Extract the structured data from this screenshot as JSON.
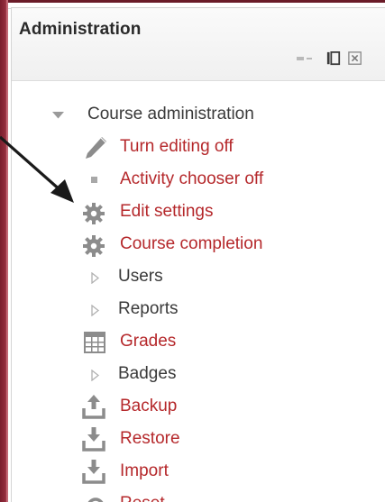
{
  "block": {
    "title": "Administration"
  },
  "admin_tree": {
    "root": {
      "label": "Course administration",
      "icon": "triangle-down-icon",
      "expanded": true
    },
    "items": [
      {
        "label": "Turn editing off",
        "icon": "pencil-icon",
        "kind": "link"
      },
      {
        "label": "Activity chooser off",
        "icon": "bullet-icon",
        "kind": "link"
      },
      {
        "label": "Edit settings",
        "icon": "gear-icon",
        "kind": "link"
      },
      {
        "label": "Course completion",
        "icon": "gear-icon",
        "kind": "link"
      },
      {
        "label": "Users",
        "icon": "triangle-right-icon",
        "kind": "branch"
      },
      {
        "label": "Reports",
        "icon": "triangle-right-icon",
        "kind": "branch"
      },
      {
        "label": "Grades",
        "icon": "table-icon",
        "kind": "link"
      },
      {
        "label": "Badges",
        "icon": "triangle-right-icon",
        "kind": "branch"
      },
      {
        "label": "Backup",
        "icon": "upload-icon",
        "kind": "link"
      },
      {
        "label": "Restore",
        "icon": "download-icon",
        "kind": "link"
      },
      {
        "label": "Import",
        "icon": "download-icon",
        "kind": "link"
      },
      {
        "label": "Reset",
        "icon": "reset-icon",
        "kind": "link"
      }
    ]
  },
  "colors": {
    "link": "#b5282b",
    "text": "#3a3a3a",
    "icon": "#8c8c8c",
    "brand_edge": "#8e2a3a"
  }
}
